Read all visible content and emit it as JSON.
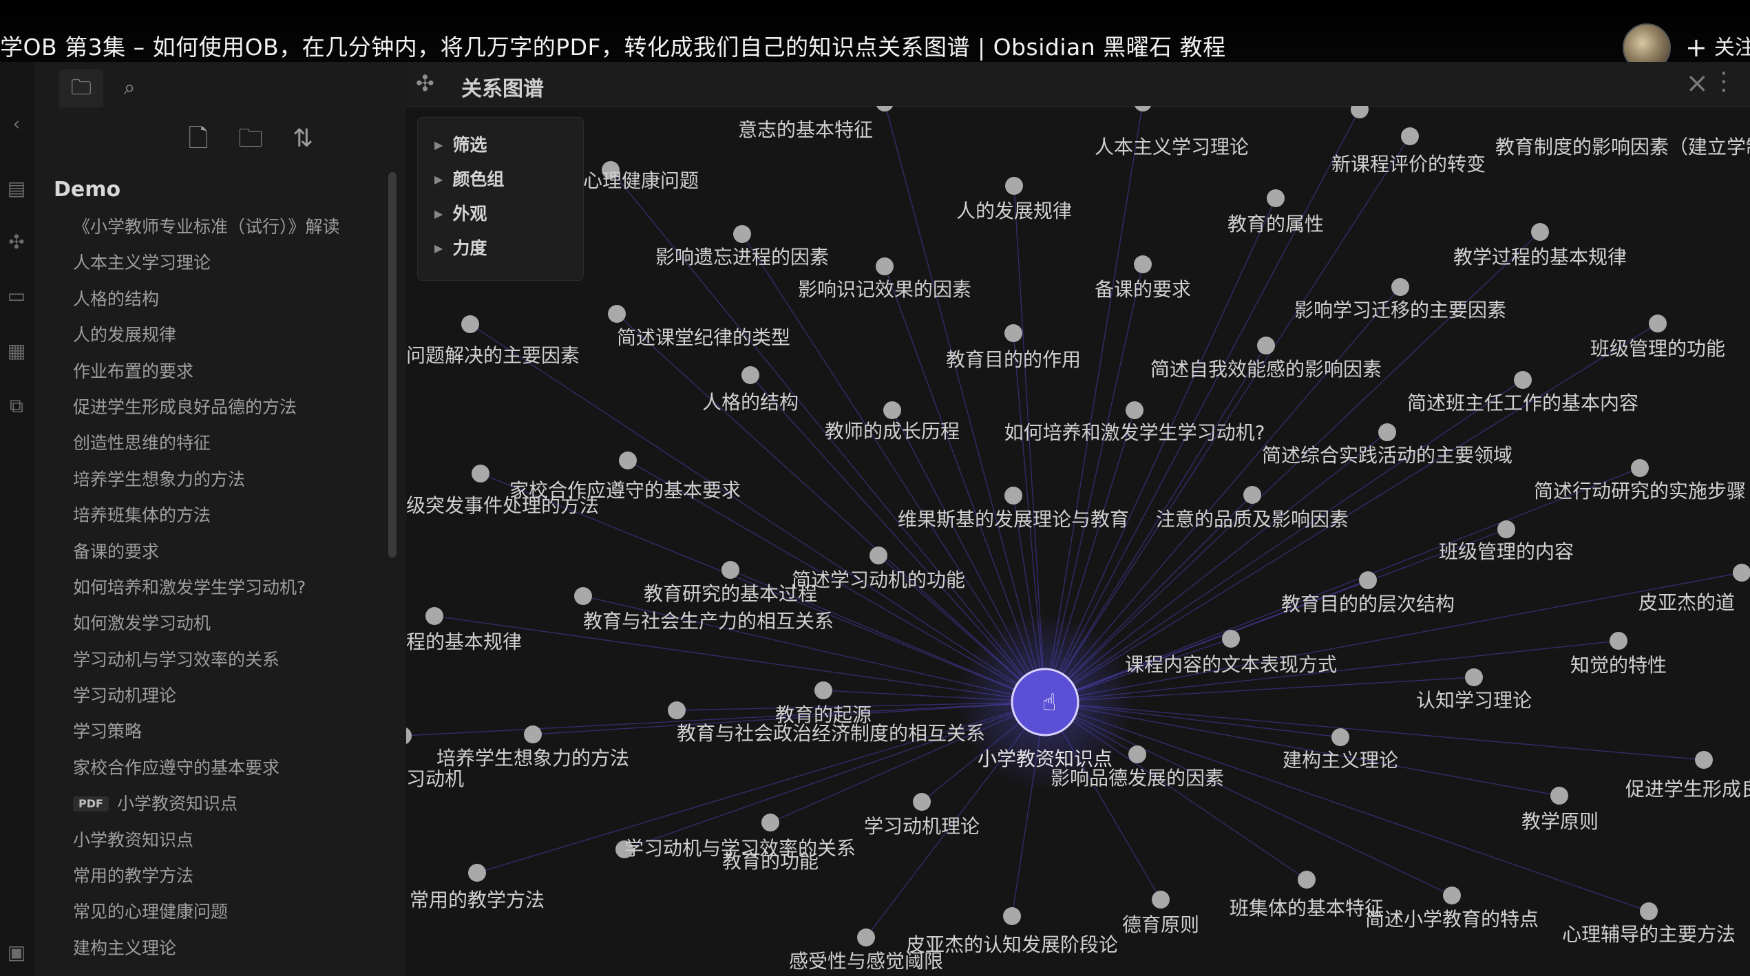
{
  "video": {
    "title": "学OB 第3集 – 如何使用OB，在几分钟内，将几万字的PDF，转化成我们自己的知识点关系图谱 | Obsidian 黑曜石 教程",
    "follow_label": "关注",
    "avatar_icon": "user-avatar-photo"
  },
  "sidebar": {
    "tabs": [
      {
        "icon": "folder-icon"
      },
      {
        "icon": "search-icon"
      }
    ],
    "actions": [
      {
        "icon": "new-note-icon"
      },
      {
        "icon": "new-folder-icon"
      },
      {
        "icon": "sort-icon"
      }
    ],
    "vault_name": "Demo",
    "files": [
      {
        "label": "《小学教师专业标准（试行）》解读"
      },
      {
        "label": "人本主义学习理论"
      },
      {
        "label": "人格的结构"
      },
      {
        "label": "人的发展规律"
      },
      {
        "label": "作业布置的要求"
      },
      {
        "label": "促进学生形成良好品德的方法"
      },
      {
        "label": "创造性思维的特征"
      },
      {
        "label": "培养学生想象力的方法"
      },
      {
        "label": "培养班集体的方法"
      },
      {
        "label": "备课的要求"
      },
      {
        "label": "如何培养和激发学生学习动机?"
      },
      {
        "label": "如何激发学习动机"
      },
      {
        "label": "学习动机与学习效率的关系"
      },
      {
        "label": "学习动机理论"
      },
      {
        "label": "学习策略"
      },
      {
        "label": "家校合作应遵守的基本要求"
      },
      {
        "label": "小学教资知识点",
        "badge": "PDF"
      },
      {
        "label": "小学教资知识点"
      },
      {
        "label": "常用的教学方法"
      },
      {
        "label": "常见的心理健康问题"
      },
      {
        "label": "建构主义理论"
      }
    ]
  },
  "graph": {
    "title": "关系图谱",
    "accent": "#5b4fd6",
    "edge_color": "#4a3fb0",
    "controls": [
      {
        "label": "筛选"
      },
      {
        "label": "颜色组"
      },
      {
        "label": "外观"
      },
      {
        "label": "力度"
      }
    ],
    "center_node": "小学教资知识点",
    "nodes": [
      {
        "label": "意志的基本特征"
      },
      {
        "label": "人本主义学习理论"
      },
      {
        "label": "教育制度的影响因素（建立学制的依据）"
      },
      {
        "label": "新课程评价的转变"
      },
      {
        "label": "心理健康问题"
      },
      {
        "label": "人的发展规律"
      },
      {
        "label": "教育的属性"
      },
      {
        "label": "教学过程的基本规律"
      },
      {
        "label": "影响遗忘进程的因素"
      },
      {
        "label": "影响识记效果的因素"
      },
      {
        "label": "备课的要求"
      },
      {
        "label": "影响学习迁移的主要因素"
      },
      {
        "label": "问题解决的主要因素"
      },
      {
        "label": "简述课堂纪律的类型"
      },
      {
        "label": "教育目的的作用"
      },
      {
        "label": "简述自我效能感的影响因素"
      },
      {
        "label": "班级管理的功能"
      },
      {
        "label": "人格的结构"
      },
      {
        "label": "教师的成长历程"
      },
      {
        "label": "如何培养和激发学生学习动机?"
      },
      {
        "label": "简述班主任工作的基本内容"
      },
      {
        "label": "简述综合实践活动的主要领域"
      },
      {
        "label": "级突发事件处理的方法"
      },
      {
        "label": "家校合作应遵守的基本要求"
      },
      {
        "label": "维果斯基的发展理论与教育"
      },
      {
        "label": "注意的品质及影响因素"
      },
      {
        "label": "简述行动研究的实施步骤"
      },
      {
        "label": "班级管理的内容"
      },
      {
        "label": "教育研究的基本过程"
      },
      {
        "label": "简述学习动机的功能"
      },
      {
        "label": "皮亚杰的道"
      },
      {
        "label": "程的基本规律"
      },
      {
        "label": "教育与社会生产力的相互关系"
      },
      {
        "label": "教育目的的层次结构"
      },
      {
        "label": "课程内容的文本表现方式"
      },
      {
        "label": "知觉的特性"
      },
      {
        "label": "认知学习理论"
      },
      {
        "label": "教育的起源"
      },
      {
        "label": "教育与社会政治经济制度的相互关系"
      },
      {
        "label": "培养学生想象力的方法"
      },
      {
        "label": "习动机"
      },
      {
        "label": "影响品德发展的因素"
      },
      {
        "label": "建构主义理论"
      },
      {
        "label": "促进学生形成良好品"
      },
      {
        "label": "教学原则"
      },
      {
        "label": "学习动机理论"
      },
      {
        "label": "学习动机与学习效率的关系"
      },
      {
        "label": "教育的功能"
      },
      {
        "label": "常用的教学方法"
      },
      {
        "label": "皮亚杰的认知发展阶段论"
      },
      {
        "label": "德育原则"
      },
      {
        "label": "班集体的基本特征"
      },
      {
        "label": "简述小学教育的特点"
      },
      {
        "label": "心理辅导的主要方法"
      },
      {
        "label": "感受性与感觉阈限"
      }
    ]
  }
}
